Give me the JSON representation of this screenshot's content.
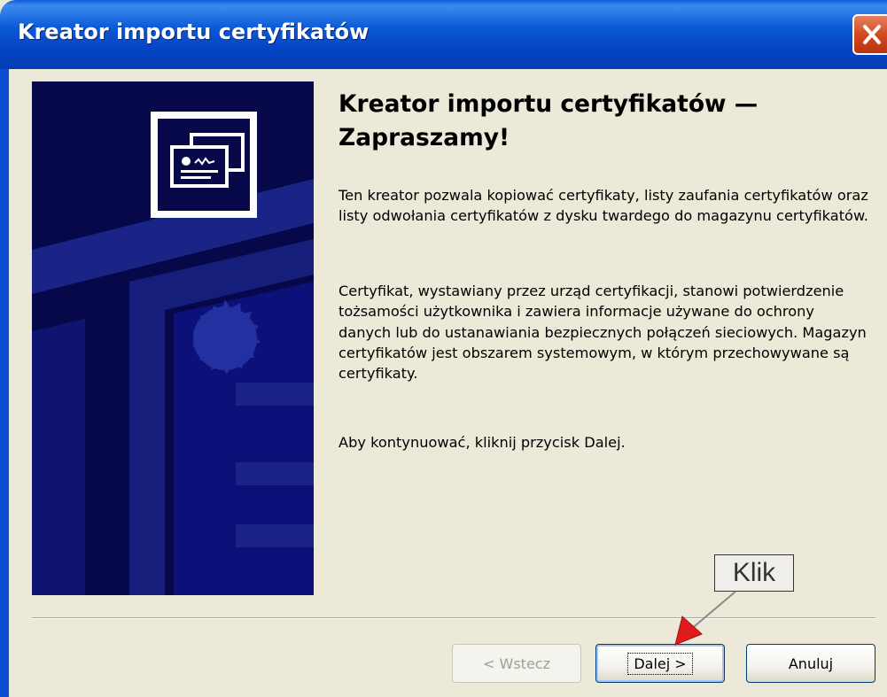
{
  "window": {
    "title": "Kreator importu certyfikatów"
  },
  "content": {
    "heading_line1": "Kreator importu certyfikatów —",
    "heading_line2": "Zapraszamy!",
    "paragraph1": "Ten kreator pozwala kopiować certyfikaty, listy zaufania certyfikatów oraz listy odwołania certyfikatów z dysku twardego do magazynu certyfikatów.",
    "paragraph2": "Certyfikat, wystawiany przez urząd certyfikacji, stanowi potwierdzenie tożsamości użytkownika i zawiera informacje używane do ochrony danych lub do ustanawiania bezpiecznych połączeń sieciowych. Magazyn certyfikatów jest obszarem systemowym, w którym przechowywane są certyfikaty.",
    "paragraph3": "Aby kontynuować, kliknij przycisk Dalej."
  },
  "buttons": {
    "back_label": "< Wstecz",
    "next_label": "Dalej >",
    "cancel_label": "Anuluj"
  },
  "annotation": {
    "callout_label": "Klik"
  },
  "icons": {
    "close": "close-icon",
    "banner": "certificate-icon"
  },
  "colors": {
    "titlebar": "#0b5ad6",
    "banner_bg": "#06084a",
    "dialog_bg": "#ece9d8",
    "close_button": "#d1461d",
    "arrow": "#e01b1b"
  }
}
